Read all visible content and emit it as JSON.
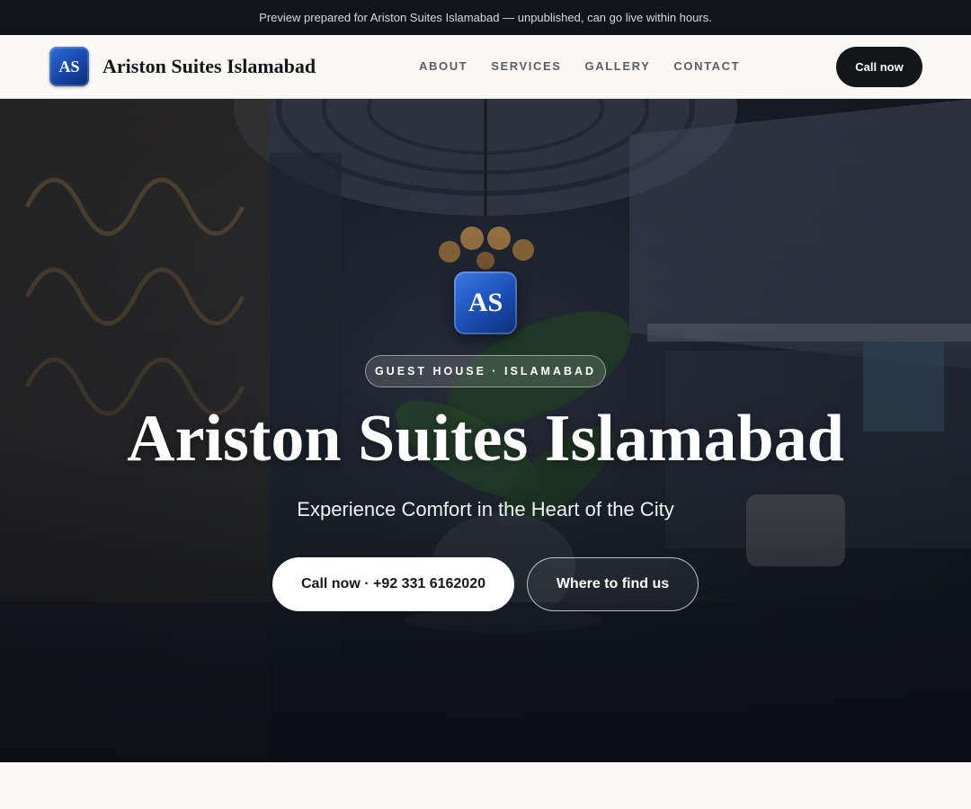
{
  "preview_bar": {
    "text": "Preview prepared for Ariston Suites Islamabad — unpublished, can go live within hours."
  },
  "header": {
    "logo_initials": "AS",
    "brand_name": "Ariston Suites Islamabad",
    "nav": [
      "ABOUT",
      "SERVICES",
      "GALLERY",
      "CONTACT"
    ],
    "call_label": "Call now"
  },
  "hero": {
    "badge_initials": "AS",
    "tag": "GUEST HOUSE · ISLAMABAD",
    "title": "Ariston Suites Islamabad",
    "subtitle": "Experience Comfort in the Heart of the City",
    "primary_button": "Call now · +92 331 6162020",
    "secondary_button": "Where to find us"
  },
  "colors": {
    "dark": "#111418",
    "brand_blue": "#1a4db4",
    "background": "#faf9f6"
  }
}
